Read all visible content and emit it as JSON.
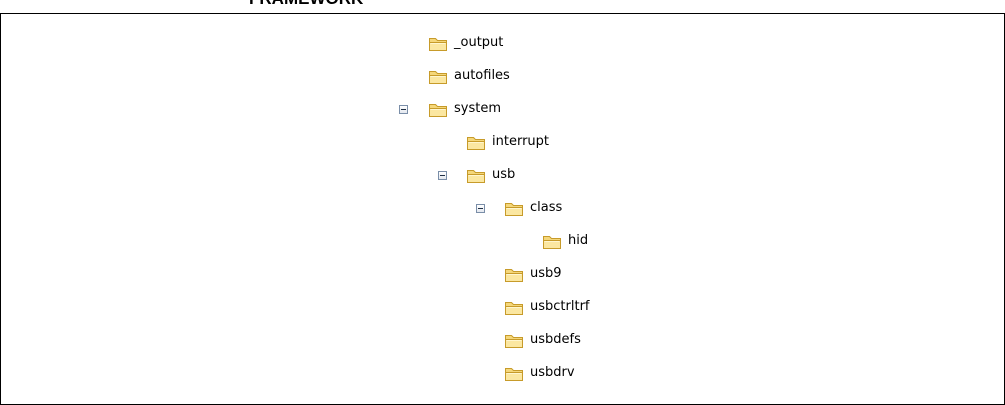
{
  "document": {
    "heading": "FRAMEWORK"
  },
  "tree": {
    "nodes": [
      {
        "label": "_output",
        "depth": 0,
        "expanded": null
      },
      {
        "label": "autofiles",
        "depth": 0,
        "expanded": null
      },
      {
        "label": "system",
        "depth": 0,
        "expanded": true
      },
      {
        "label": "interrupt",
        "depth": 1,
        "expanded": null
      },
      {
        "label": "usb",
        "depth": 1,
        "expanded": true
      },
      {
        "label": "class",
        "depth": 2,
        "expanded": true
      },
      {
        "label": "hid",
        "depth": 3,
        "expanded": null
      },
      {
        "label": "usb9",
        "depth": 2,
        "expanded": null
      },
      {
        "label": "usbctrltrf",
        "depth": 2,
        "expanded": null
      },
      {
        "label": "usbdefs",
        "depth": 2,
        "expanded": null
      },
      {
        "label": "usbdrv",
        "depth": 2,
        "expanded": null
      }
    ]
  },
  "icons": {
    "folder": "folder-icon",
    "collapse": "minus-box-icon"
  },
  "colors": {
    "folder_fill": "#f5d77a",
    "folder_edge": "#c79b2a",
    "toggle_border": "#7a8ea8"
  }
}
